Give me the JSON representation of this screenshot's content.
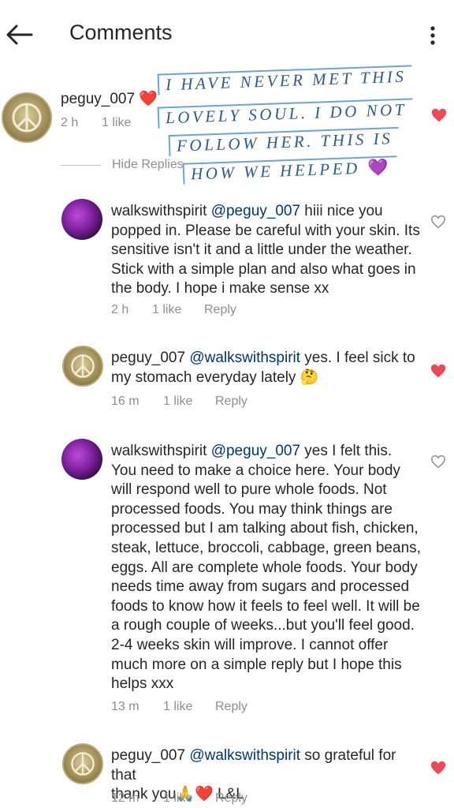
{
  "header": {
    "title": "Comments"
  },
  "icons": {
    "back": "arrow-left-icon",
    "menu": "more-vertical-icon",
    "like": "heart-icon"
  },
  "colors": {
    "mention": "#00376b",
    "liked": "#ed4956",
    "meta": "#8e8e8e",
    "note_text": "#2f5a8a",
    "note_border": "#6fa3d8"
  },
  "parent_comment": {
    "username": "peguy_007",
    "time": "2 h",
    "likes": "1 like"
  },
  "hide_replies_label": "Hide Replies",
  "overlay_note": {
    "lines": [
      "I HAVE NEVER MET THIS",
      "LOVELY SOUL.  I DO NOT",
      "FOLLOW HER.  THIS IS",
      "HOW WE HELPED"
    ]
  },
  "replies": [
    {
      "username": "walkswithspirit",
      "mention": "@peguy_007",
      "text_lines": [
        " hiii nice you",
        "popped in. Please be careful with your skin. Its",
        "sensitive isn't it and a little under the weather.",
        "Stick with a simple plan and also what goes in",
        "the body.  I hope i make sense xx"
      ],
      "time": "2 h",
      "likes": "1 like",
      "reply": "Reply",
      "liked": false
    },
    {
      "username": "peguy_007",
      "mention": "@walkswithspirit",
      "text_lines": [
        " yes.  I feel sick to",
        "my stomach everyday lately 🤔"
      ],
      "time": "16 m",
      "likes": "1 like",
      "reply": "Reply",
      "liked": true
    },
    {
      "username": "walkswithspirit",
      "mention": "@peguy_007",
      "text_lines": [
        " yes I felt this.",
        "You need to make a choice here. Your body",
        "will respond well to pure whole foods. Not",
        "processed foods. You may think things are",
        "processed but I am talking about fish, chicken,",
        "steak, lettuce, broccoli, cabbage, green beans,",
        "eggs. All are complete whole foods. Your body",
        "needs time away from sugars and processed",
        "foods to know how it feels to feel well.  It will be",
        "a rough couple of weeks...but you'll feel good.",
        "2-4 weeks skin will improve.  I cannot offer",
        "much more on a simple reply but I hope this",
        "helps xxx"
      ],
      "time": "13 m",
      "likes": "1 like",
      "reply": "Reply",
      "liked": false
    },
    {
      "username": "peguy_007",
      "mention": "@walkswithspirit",
      "text_lines": [
        " so grateful for that",
        "thank you🙏❤️ L&L"
      ],
      "time": "12 m",
      "likes": "1 like",
      "reply": "Reply",
      "liked": true
    }
  ]
}
